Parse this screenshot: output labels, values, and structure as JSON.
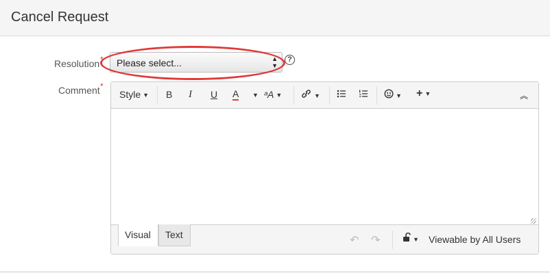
{
  "dialog": {
    "title": "Cancel Request"
  },
  "resolution": {
    "label": "Resolution",
    "required_marker": "*",
    "selected_value": "Please select...",
    "help": "?"
  },
  "comment": {
    "label": "Comment",
    "required_marker": "*",
    "toolbar": {
      "style_label": "Style",
      "bold": "B",
      "italic": "I",
      "underline": "U",
      "text_color": "A",
      "clear_format": "ᵃA"
    },
    "tabs": [
      "Visual",
      "Text"
    ],
    "visibility": "Viewable by All Users"
  },
  "colors": {
    "required": "#d04437",
    "highlight": "#e03a3a",
    "text_color_underline": "#d04437"
  }
}
